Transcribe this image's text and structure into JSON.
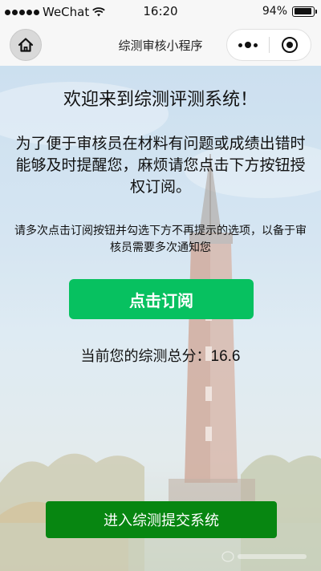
{
  "status_bar": {
    "carrier": "WeChat",
    "time": "16:20",
    "battery_percent": "94%",
    "battery_level": 0.94
  },
  "nav_bar": {
    "title": "综测审核小程序",
    "home_icon": "home-icon",
    "more_icon": "more-dots-icon",
    "close_icon": "target-close-icon"
  },
  "main": {
    "welcome": "欢迎来到综测评测系统！",
    "intro": "为了便于审核员在材料有问题或成绩出错时能够及时提醒您，麻烦请您点击下方按钮授权订阅。",
    "hint": "请多次点击订阅按钮并勾选下方不再提示的选项，以备于审核员需要多次通知您",
    "subscribe_label": "点击订阅",
    "score_label": "当前您的综测总分：",
    "score_value": "16.6",
    "enter_label": "进入综测提交系统"
  },
  "colors": {
    "subscribe_bg": "#07c160",
    "enter_bg": "#078611",
    "bar_bg": "#f7f7f7"
  }
}
